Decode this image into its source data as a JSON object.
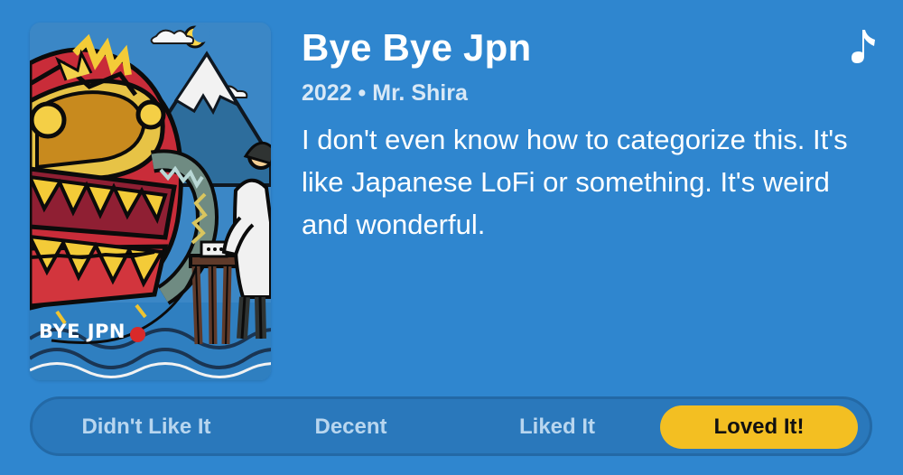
{
  "album": {
    "title": "Bye Bye Jpn",
    "meta": "2022 • Mr. Shira",
    "description": "I don't even know how to categorize this. It's like Japanese LoFi or something. It's weird and wonderful.",
    "cover_text": "BYE JPN",
    "icon": "music-note-icon"
  },
  "ratings": {
    "options": [
      "Didn't Like It",
      "Decent",
      "Liked It",
      "Loved It!"
    ],
    "selected": "Loved It!"
  },
  "colors": {
    "background": "#2f86cf",
    "selected": "#f3bf22",
    "selected_text": "#111111",
    "muted_text": "#b8d6ef"
  }
}
